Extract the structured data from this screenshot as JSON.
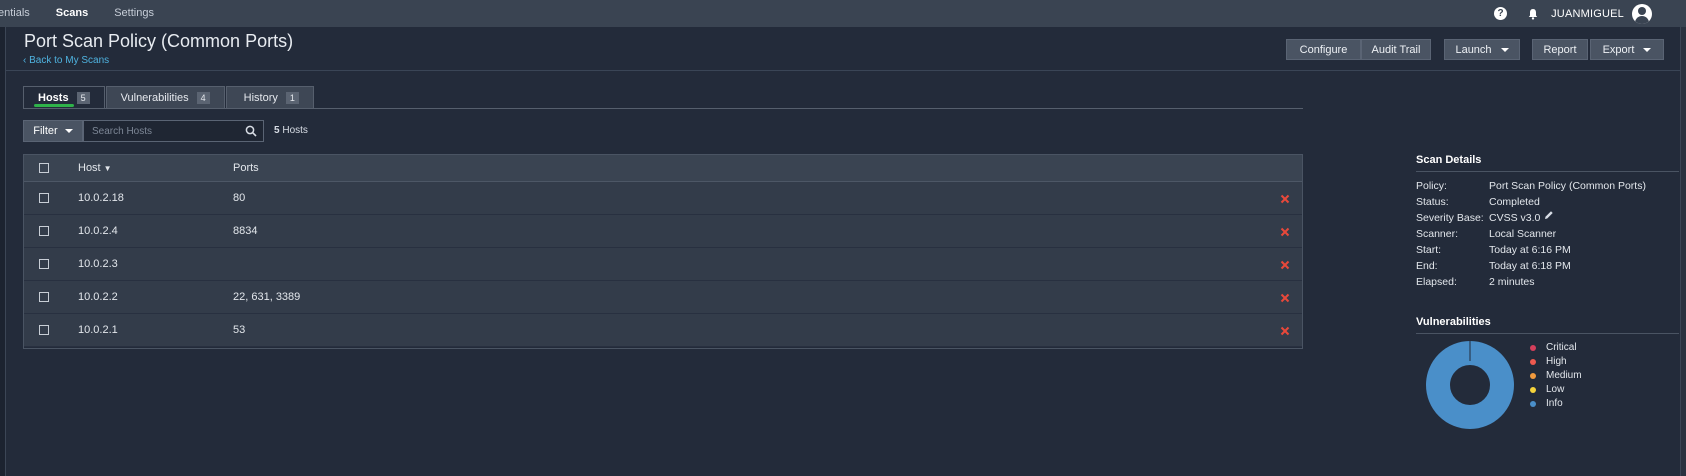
{
  "nav": {
    "items": [
      {
        "label": "entials",
        "active": false
      },
      {
        "label": "Scans",
        "active": true
      },
      {
        "label": "Settings",
        "active": false
      }
    ],
    "help_icon": "question-icon",
    "bell_icon": "bell-icon",
    "username": "JUANMIGUEL"
  },
  "header": {
    "title": "Port Scan Policy (Common Ports)",
    "back_link": "‹ Back to My Scans",
    "buttons": {
      "configure": "Configure",
      "audit_trail": "Audit Trail",
      "launch": "Launch",
      "report": "Report",
      "export": "Export"
    }
  },
  "tabs": [
    {
      "label": "Hosts",
      "count": "5",
      "active": true
    },
    {
      "label": "Vulnerabilities",
      "count": "4",
      "active": false
    },
    {
      "label": "History",
      "count": "1",
      "active": false
    }
  ],
  "filter": {
    "button_label": "Filter",
    "search_placeholder": "Search Hosts",
    "count_number": "5",
    "count_label": "Hosts"
  },
  "table": {
    "columns": [
      "Host",
      "Ports"
    ],
    "rows": [
      {
        "host": "10.0.2.18",
        "ports": "80"
      },
      {
        "host": "10.0.2.4",
        "ports": "8834"
      },
      {
        "host": "10.0.2.3",
        "ports": ""
      },
      {
        "host": "10.0.2.2",
        "ports": "22, 631, 3389"
      },
      {
        "host": "10.0.2.1",
        "ports": "53"
      }
    ]
  },
  "scan_details": {
    "title": "Scan Details",
    "items": [
      {
        "label": "Policy:",
        "value": "Port Scan Policy (Common Ports)"
      },
      {
        "label": "Status:",
        "value": "Completed"
      },
      {
        "label": "Severity Base:",
        "value": "CVSS v3.0"
      },
      {
        "label": "Scanner:",
        "value": "Local Scanner"
      },
      {
        "label": "Start:",
        "value": "Today at 6:16 PM"
      },
      {
        "label": "End:",
        "value": "Today at 6:18 PM"
      },
      {
        "label": "Elapsed:",
        "value": "2 minutes"
      }
    ]
  },
  "vulnerabilities": {
    "title": "Vulnerabilities",
    "legend": [
      {
        "label": "Critical",
        "color": "#d43f5b",
        "value": 0
      },
      {
        "label": "High",
        "color": "#ee5a4f",
        "value": 0
      },
      {
        "label": "Medium",
        "color": "#f19a3e",
        "value": 0
      },
      {
        "label": "Low",
        "color": "#f5d33b",
        "value": 0
      },
      {
        "label": "Info",
        "color": "#4a8fc9",
        "value": 4
      }
    ]
  },
  "colors": {
    "accent_blue": "#4fb3e0",
    "tab_underline": "#2fb34a",
    "remove_red": "#e8483a",
    "donut": "#4a8fc9"
  }
}
